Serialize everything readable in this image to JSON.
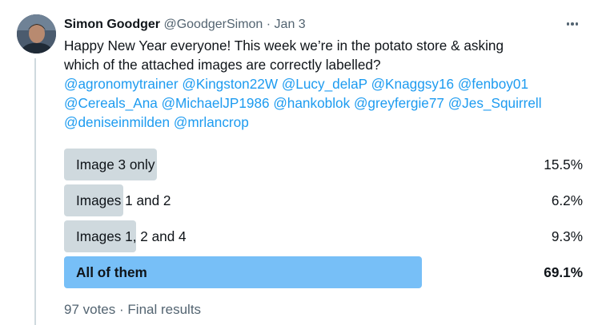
{
  "tweet": {
    "author_name": "Simon Goodger",
    "author_handle": "@GoodgerSimon",
    "separator": "·",
    "date": "Jan 3",
    "text_lines": [
      "Happy New Year everyone! This week we’re in the potato store & asking",
      "which of the attached images are correctly labelled?"
    ],
    "mentions": [
      "@agronomytrainer",
      "@Kingston22W",
      "@Lucy_delaP",
      "@Knaggsy16",
      "@fenboy01",
      "@Cereals_Ana",
      "@MichaelJP1986",
      "@hankoblok",
      "@greyfergie77",
      "@Jes_Squirrell",
      "@deniseinmilden",
      "@mrlancrop"
    ],
    "more_icon": "more-horizontal-icon"
  },
  "poll": {
    "options": [
      {
        "label": "Image 3 only",
        "percent_text": "15.5%",
        "share": 0.155,
        "winner": false
      },
      {
        "label": "Images 1 and 2",
        "percent_text": "6.2%",
        "share": 0.062,
        "winner": false
      },
      {
        "label": "Images 1, 2 and 4",
        "percent_text": "9.3%",
        "share": 0.093,
        "winner": false
      },
      {
        "label": "All of them",
        "percent_text": "69.1%",
        "share": 0.691,
        "winner": true
      }
    ],
    "votes_text": "97 votes",
    "separator": "·",
    "status_text": "Final results",
    "colors": {
      "bar": "#cfd9de",
      "winner_bar": "#77bff7",
      "mention": "#1d9bf0"
    }
  }
}
